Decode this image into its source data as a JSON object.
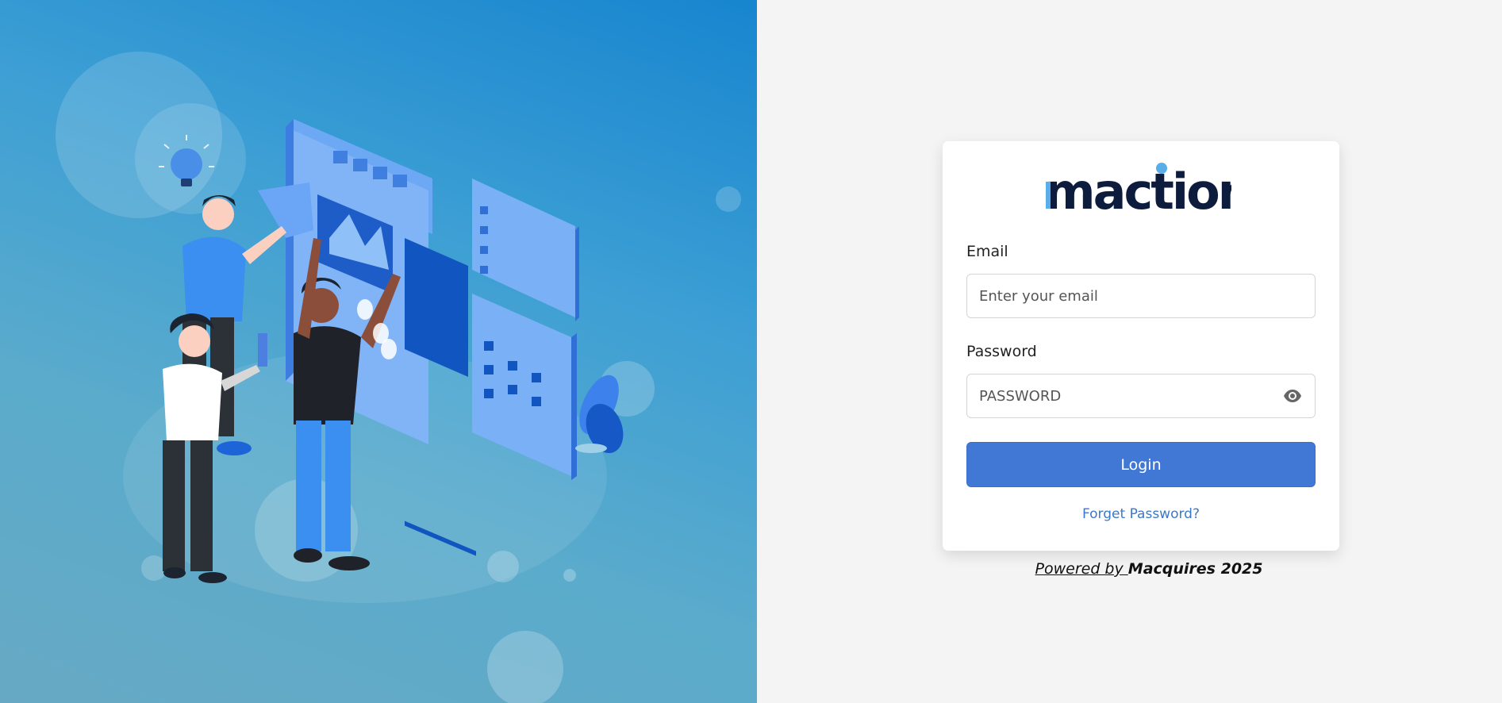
{
  "logo": {
    "text": "maction",
    "primary_color": "#0d1b3d",
    "accent_color": "#5aaee8"
  },
  "form": {
    "email_label": "Email",
    "email_placeholder": "Enter your email",
    "email_value": "",
    "password_label": "Password",
    "password_placeholder": "PASSWORD",
    "password_value": "",
    "password_toggle_icon": "eye-icon",
    "login_label": "Login",
    "forgot_label": "Forget Password?"
  },
  "footer": {
    "powered_prefix": "Powered by ",
    "powered_brand": "Macquires 2025"
  },
  "colors": {
    "primary_button": "#4178d6",
    "link": "#3c78c9",
    "background": "#f4f4f4",
    "hero_gradient_top": "#1785cf",
    "hero_gradient_bottom": "#67a9c4"
  },
  "illustration": {
    "name": "team-collaboration-illustration"
  }
}
